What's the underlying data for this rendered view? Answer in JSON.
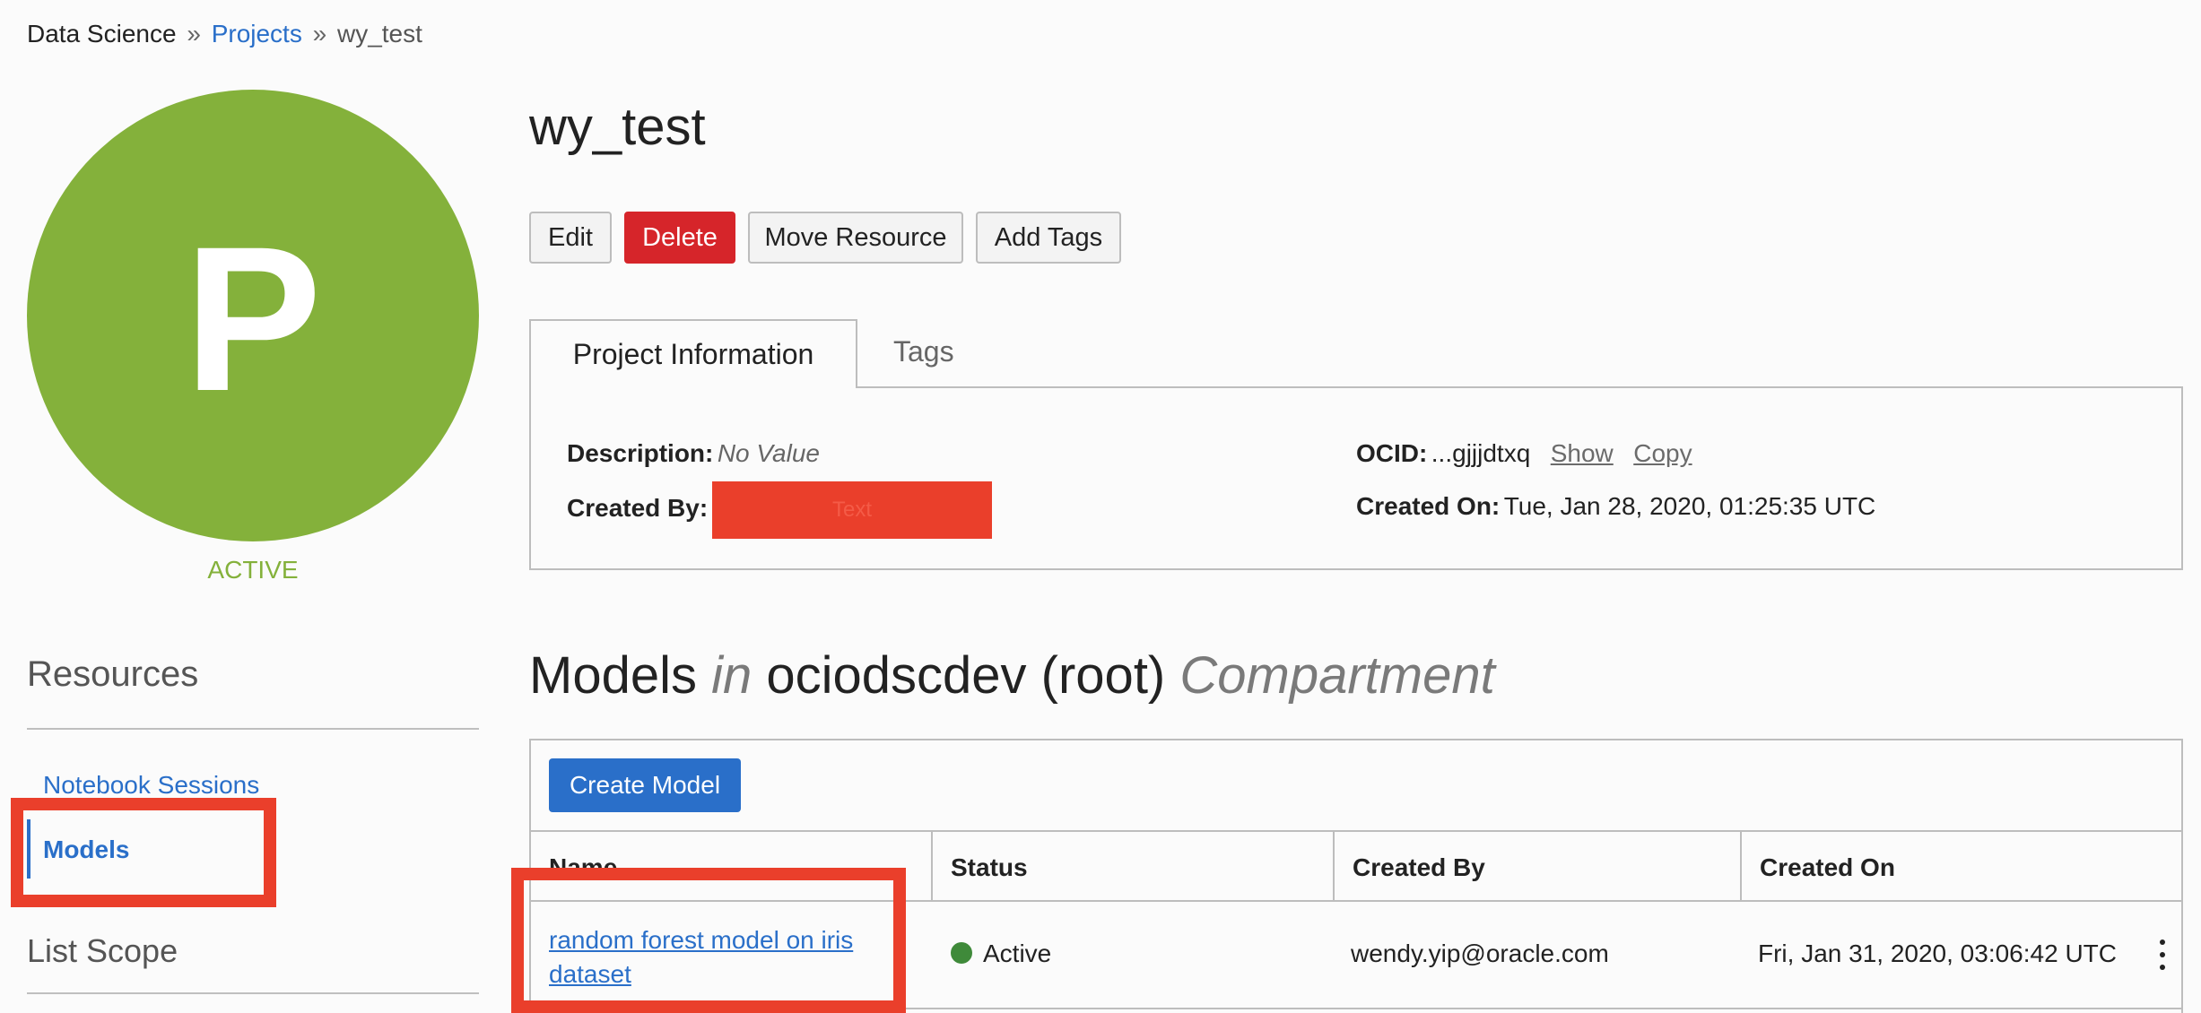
{
  "breadcrumb": {
    "root": "Data Science",
    "separator": "»",
    "projects": "Projects",
    "current": "wy_test"
  },
  "avatar": {
    "letter": "P",
    "status": "ACTIVE",
    "color": "#84b13b"
  },
  "sidebar": {
    "resources_heading": "Resources",
    "items": [
      {
        "label": "Notebook Sessions",
        "active": false
      },
      {
        "label": "Models",
        "active": true
      }
    ],
    "list_scope_heading": "List Scope"
  },
  "page": {
    "title": "wy_test"
  },
  "actions": {
    "edit": "Edit",
    "delete": "Delete",
    "move_resource": "Move Resource",
    "add_tags": "Add Tags"
  },
  "tabs": [
    {
      "label": "Project Information",
      "active": true
    },
    {
      "label": "Tags",
      "active": false
    }
  ],
  "project_info": {
    "description_label": "Description:",
    "description_value": "No Value",
    "created_by_label": "Created By:",
    "created_by_redacted": "Text",
    "ocid_label": "OCID:",
    "ocid_value": "...gjjjdtxq",
    "show_link": "Show",
    "copy_link": "Copy",
    "created_on_label": "Created On:",
    "created_on_value": "Tue, Jan 28, 2020, 01:25:35 UTC"
  },
  "models_section": {
    "heading_prefix": "Models",
    "heading_in": "in",
    "compartment": "ociodscdev (root)",
    "heading_suffix": "Compartment",
    "create_button": "Create Model",
    "columns": [
      "Name",
      "Status",
      "Created By",
      "Created On"
    ],
    "rows": [
      {
        "name": "random forest model on iris dataset",
        "status": "Active",
        "created_by": "wendy.yip@oracle.com",
        "created_on": "Fri, Jan 31, 2020, 03:06:42 UTC"
      }
    ]
  },
  "colors": {
    "accent": "#2a6fc9",
    "delete": "#d6252a",
    "highlight": "#ea3f2b",
    "active_status": "#3f8a3a"
  }
}
